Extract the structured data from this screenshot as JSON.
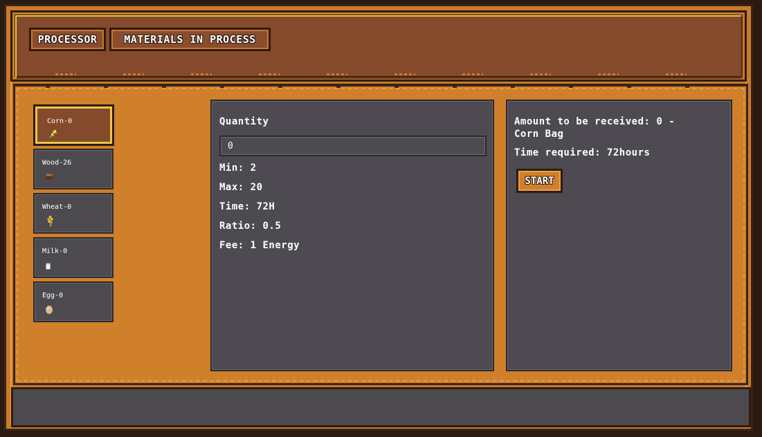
{
  "tabs": [
    {
      "label": "PROCESSOR"
    },
    {
      "label": "MATERIALS IN PROCESS"
    }
  ],
  "materials": [
    {
      "label": "Corn-0",
      "icon": "corn-icon",
      "selected": true
    },
    {
      "label": "Wood-26",
      "icon": "wood-icon",
      "selected": false
    },
    {
      "label": "Wheat-0",
      "icon": "wheat-icon",
      "selected": false
    },
    {
      "label": "Milk-0",
      "icon": "milk-icon",
      "selected": false
    },
    {
      "label": "Egg-0",
      "icon": "egg-icon",
      "selected": false
    }
  ],
  "process": {
    "quantity_label": "Quantity",
    "quantity_value": "0",
    "min": "Min: 2",
    "max": "Max: 20",
    "time": "Time: 72H",
    "ratio": "Ratio: 0.5",
    "fee": "Fee: 1 Energy"
  },
  "result": {
    "amount_line1": "Amount to be received: 0 -",
    "amount_line2": "Corn Bag",
    "time_required": "Time required: 72hours",
    "start_label": "START"
  },
  "colors": {
    "frame_orange": "#d07f2a",
    "header_brown": "#854a2c",
    "panel_gray": "#4d4b51",
    "gold_accent": "#e7c94a"
  }
}
